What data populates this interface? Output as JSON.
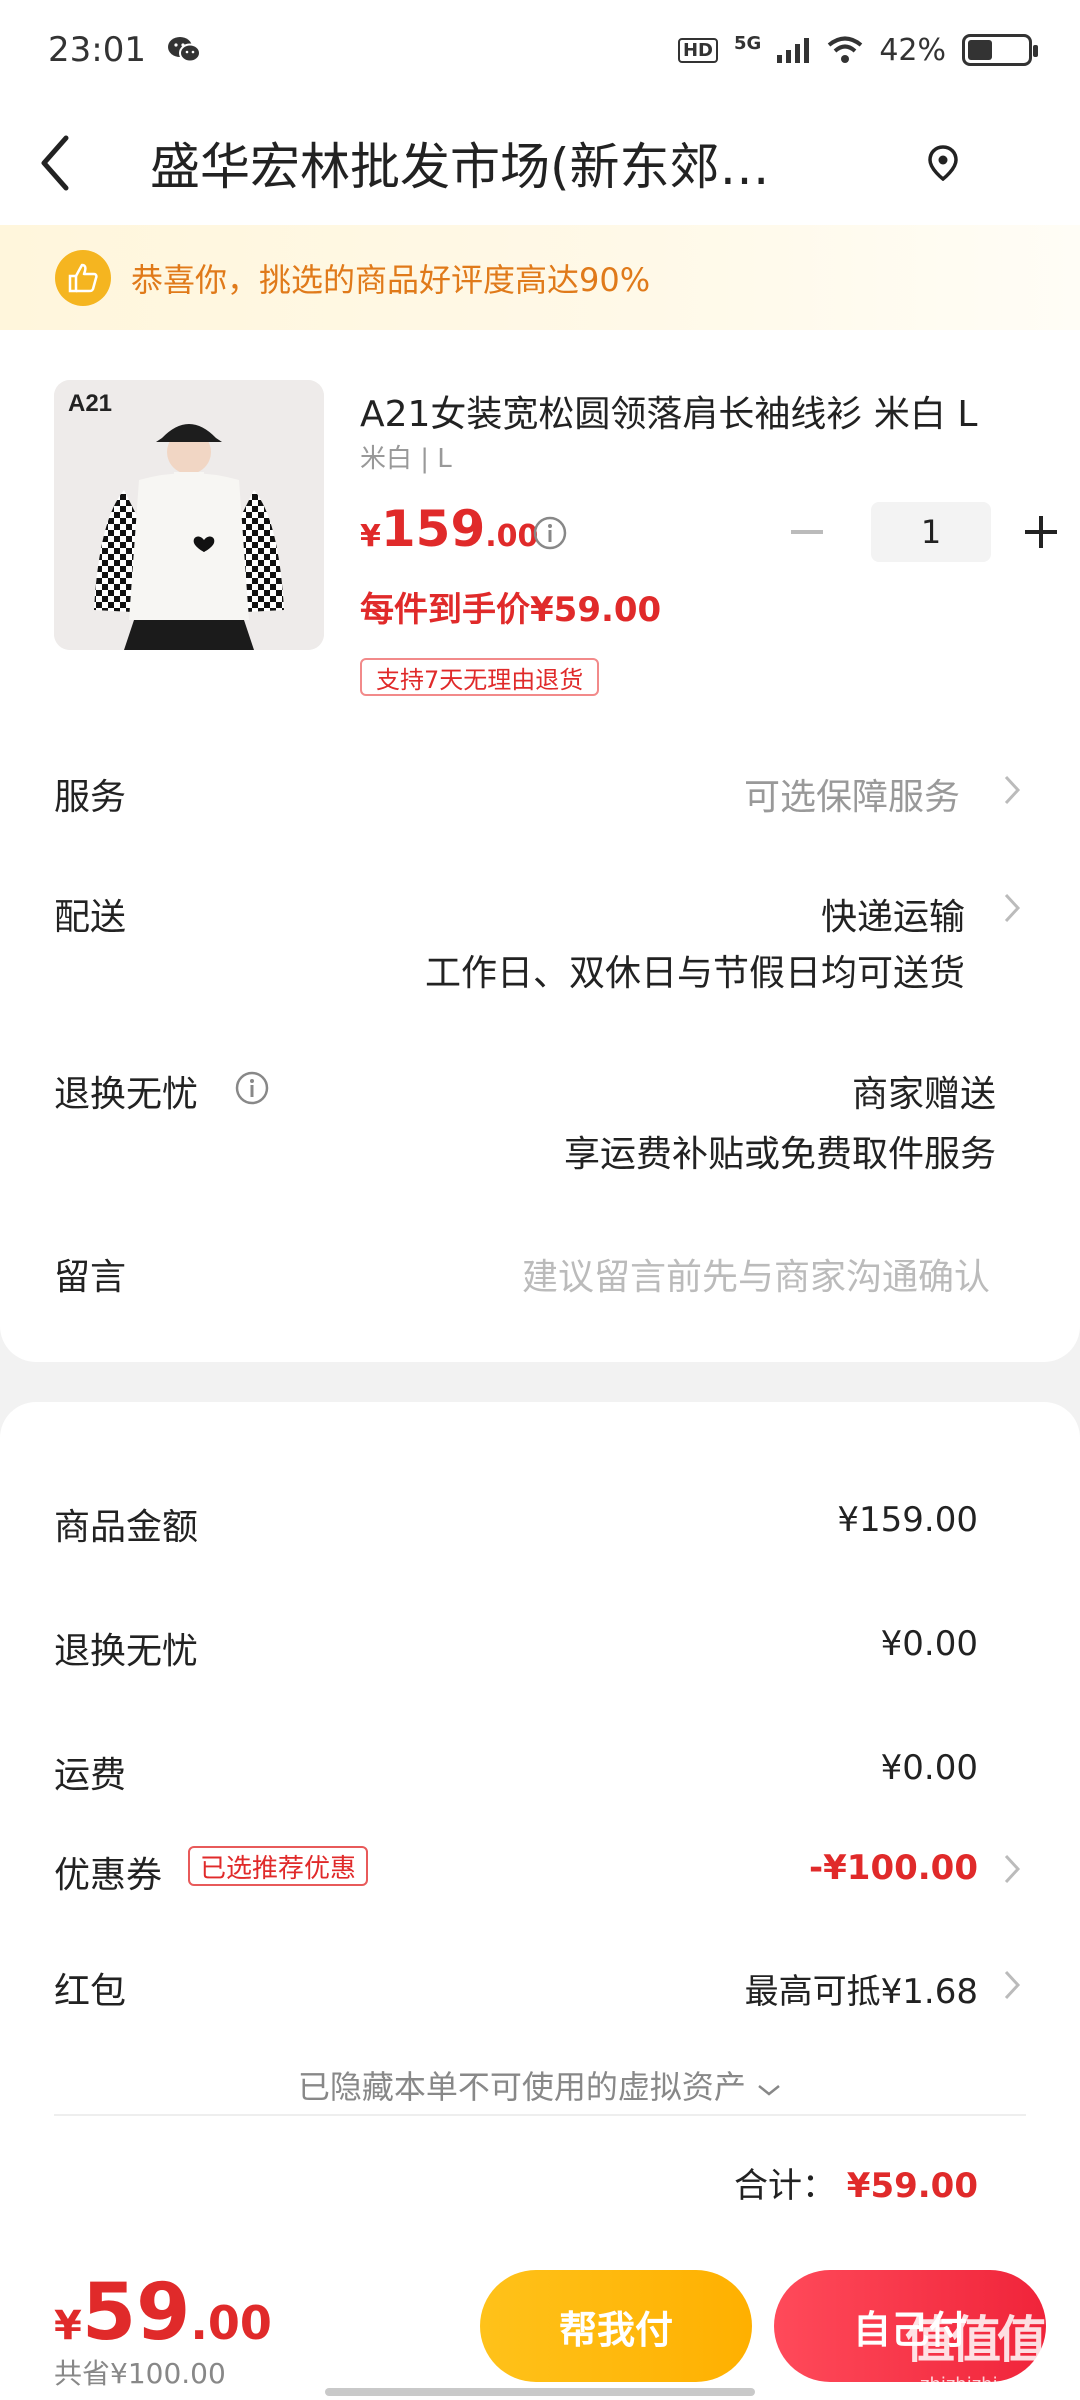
{
  "status_bar": {
    "time": "23:01",
    "network_badge": "HD",
    "network_type": "5G",
    "battery": "42%",
    "battery_level": 0.42
  },
  "header": {
    "title": "盛华宏林批发市场(新东郊…",
    "back_icon": "chevron-left-icon",
    "location_icon": "location-pin-icon"
  },
  "notice": {
    "text": "恭喜你，挑选的商品好评度高达90%",
    "icon": "thumbs-up-icon",
    "color": "#e07a1a"
  },
  "product": {
    "image_brand": "A21",
    "title": "A21女装宽松圆领落肩长袖线衫 米白 L",
    "sku": "米白 | L",
    "price_symbol": "¥",
    "price_int": "159",
    "price_dec": ".00",
    "quantity": "1",
    "per_price": "每件到手价¥59.00",
    "return_tag": "支持7天无理由退货"
  },
  "options": {
    "service_label": "服务",
    "service_value": "可选保障服务",
    "delivery_label": "配送",
    "delivery_value": "快递运输",
    "delivery_note": "工作日、双休日与节假日均可送货",
    "return_label": "退换无忧",
    "return_value": "商家赠送",
    "return_note": "享运费补贴或免费取件服务",
    "message_label": "留言",
    "message_placeholder": "建议留言前先与商家沟通确认"
  },
  "summary": {
    "goods_label": "商品金额",
    "goods_value": "¥159.00",
    "return_label": "退换无忧",
    "return_value": "¥0.00",
    "shipping_label": "运费",
    "shipping_value": "¥0.00",
    "coupon_label": "优惠券",
    "coupon_tag": "已选推荐优惠",
    "coupon_value": "-¥100.00",
    "redpacket_label": "红包",
    "redpacket_value": "最高可抵¥1.68",
    "hidden_assets": "已隐藏本单不可使用的虚拟资产",
    "total_label": "合计：",
    "total_value": "¥59.00"
  },
  "bottom": {
    "price_symbol": "¥",
    "price_int": "59",
    "price_dec": ".00",
    "saved": "共省¥100.00",
    "help_pay": "帮我付",
    "self_pay": "自己付"
  },
  "watermark": {
    "text": "值值值",
    "sub": "zhizhizhi.com"
  },
  "colors": {
    "price_red": "#e02a2a",
    "help_button": "#ffb000",
    "self_button": "#f0243a"
  }
}
